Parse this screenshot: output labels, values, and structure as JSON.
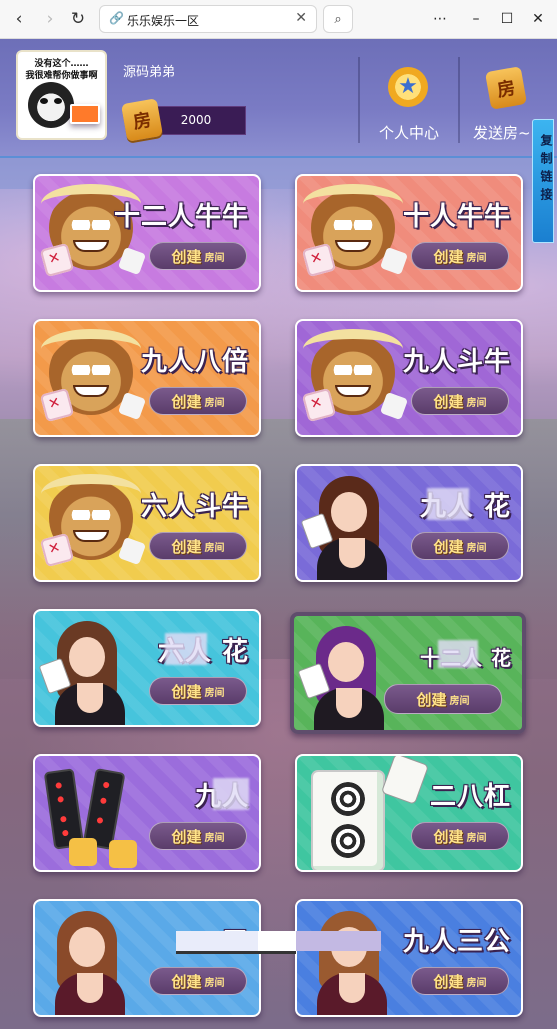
{
  "browser": {
    "back_icon": "‹",
    "forward_icon": "›",
    "reload_icon": "↻",
    "tab_title": "乐乐娱乐一区",
    "tab_close": "✕",
    "search_icon": "⌕",
    "more_icon": "⋯",
    "minimize_icon": "–",
    "maximize_icon": "☐",
    "close_icon": "✕"
  },
  "header": {
    "avatar_caption_line1": "没有这个……",
    "avatar_caption_line2": "我很难帮你做事啊",
    "username": "源码弟弟",
    "room_cards": "2000",
    "room_icon_text": "房",
    "personal_center_label": "个人中心",
    "send_room_label": "发送房~",
    "send_room_icon_text": "房",
    "copy_link_label": "复制链接"
  },
  "cards": [
    {
      "title": "十二人牛牛",
      "create_main": "创建",
      "create_sub": "房间",
      "theme": "pink"
    },
    {
      "title": "十人牛牛",
      "create_main": "创建",
      "create_sub": "房间",
      "theme": "salmon"
    },
    {
      "title": "九人八倍",
      "create_main": "创建",
      "create_sub": "房间",
      "theme": "orange"
    },
    {
      "title": "九人斗牛",
      "create_main": "创建",
      "create_sub": "房间",
      "theme": "purple"
    },
    {
      "title": "六人斗牛",
      "create_main": "创建",
      "create_sub": "房间",
      "theme": "yellow"
    },
    {
      "title": "九人 花",
      "create_main": "创建",
      "create_sub": "房间",
      "theme": "violet"
    },
    {
      "title": "六人 花",
      "create_main": "创建",
      "create_sub": "房间",
      "theme": "cyan"
    },
    {
      "title": "十二人 花",
      "create_main": "创建",
      "create_sub": "房间",
      "theme": "green"
    },
    {
      "title": "九人",
      "create_main": "创建",
      "create_sub": "房间",
      "theme": "lavender"
    },
    {
      "title": "二八杠",
      "create_main": "创建",
      "create_sub": "房间",
      "theme": "teal"
    },
    {
      "title": "三",
      "create_main": "创建",
      "create_sub": "房间",
      "theme": "sky"
    },
    {
      "title": "九人三公",
      "create_main": "创建",
      "create_sub": "房间",
      "theme": "blue"
    }
  ],
  "colors": {
    "pink": "#c77be0",
    "salmon": "#f08c7c",
    "orange": "#f39a4a",
    "purple": "#a067d6",
    "yellow": "#f1cc4e",
    "violet": "#7a6bd8",
    "cyan": "#46c4dc",
    "green": "#58b45a",
    "lavender": "#9b6ddc",
    "teal": "#3fc6a0",
    "sky": "#5aa9e8",
    "blue": "#4a7fe0"
  }
}
